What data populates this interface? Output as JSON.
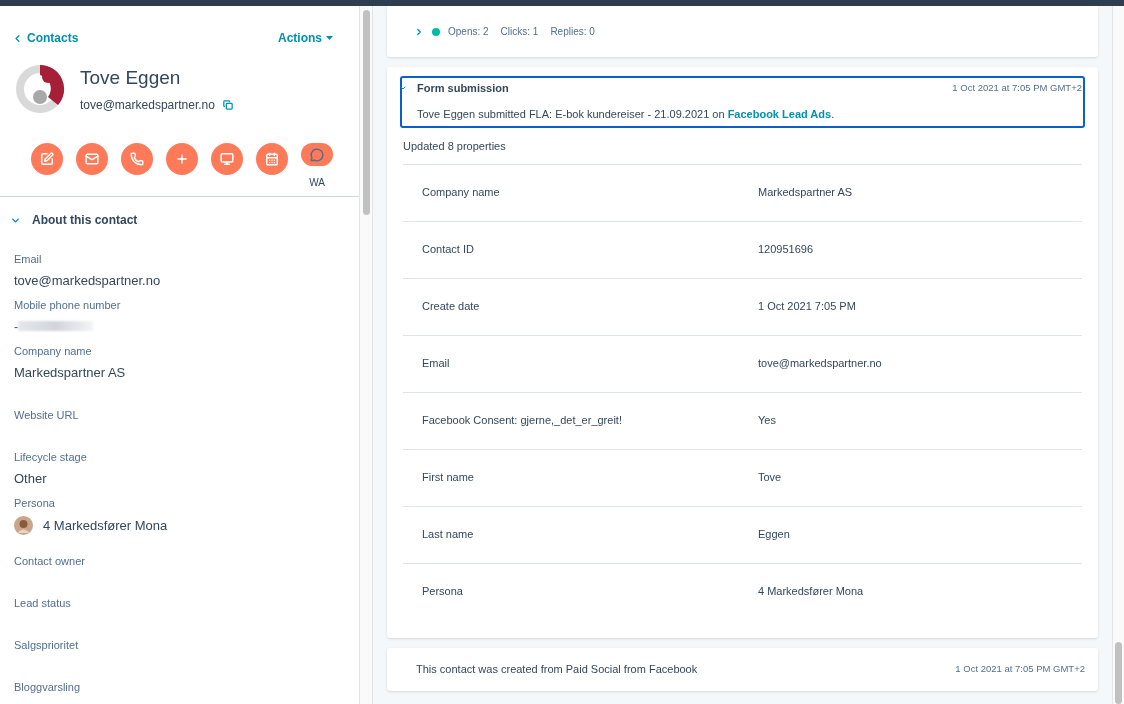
{
  "header": {
    "back_link": "Contacts",
    "actions_menu": "Actions"
  },
  "contact": {
    "name": "Tove Eggen",
    "email": "tove@markedspartner.no"
  },
  "action_buttons": [
    {
      "kind": "note"
    },
    {
      "kind": "email"
    },
    {
      "kind": "call"
    },
    {
      "kind": "add"
    },
    {
      "kind": "screen"
    },
    {
      "kind": "meeting"
    },
    {
      "kind": "whatsapp",
      "label": "WA"
    }
  ],
  "about": {
    "title": "About this contact",
    "expanded": true,
    "fields": [
      {
        "kind": "text",
        "label": "Email",
        "value": "tove@markedspartner.no"
      },
      {
        "kind": "redacted",
        "label": "Mobile phone number",
        "value": "-"
      },
      {
        "kind": "text",
        "label": "Company name",
        "value": "Markedspartner AS"
      },
      {
        "kind": "empty",
        "label": "Website URL"
      },
      {
        "kind": "text",
        "label": "Lifecycle stage",
        "value": "Other"
      },
      {
        "kind": "persona",
        "label": "Persona",
        "value": "4 Markedsfører Mona"
      },
      {
        "kind": "empty",
        "label": "Contact owner"
      },
      {
        "kind": "empty",
        "label": "Lead status"
      },
      {
        "kind": "empty",
        "label": "Salgsprioritet"
      },
      {
        "kind": "empty",
        "label": "Bloggvarsling"
      }
    ]
  },
  "email_activity": {
    "expanded": false,
    "stats": [
      "Opens: 2",
      "Clicks: 1",
      "Replies: 0"
    ]
  },
  "form_submission": {
    "title": "Form submission",
    "time": "1 Oct 2021 at 7:05 PM GMT+2",
    "expanded": true,
    "text": "Tove Eggen submitted FLA: E-bok kundereiser - 21.09.2021 on ",
    "link": "Facebook Lead Ads",
    "text_end": ".",
    "updated": "Updated 8 properties",
    "properties": [
      {
        "name": "Company name",
        "value": "Markedspartner AS"
      },
      {
        "name": "Contact ID",
        "value": "120951696"
      },
      {
        "name": "Create date",
        "value": "1 Oct 2021 7:05 PM"
      },
      {
        "name": "Email",
        "value": "tove@markedspartner.no"
      },
      {
        "name": "Facebook Consent: gjerne,_det_er_greit!",
        "value": "Yes"
      },
      {
        "name": "First name",
        "value": "Tove"
      },
      {
        "name": "Last name",
        "value": "Eggen"
      },
      {
        "name": "Persona",
        "value": "4 Markedsfører Mona"
      }
    ]
  },
  "creation_event": {
    "text": "This contact was created from Paid Social from Facebook",
    "time": "1 Oct 2021 at 7:05 PM GMT+2"
  }
}
